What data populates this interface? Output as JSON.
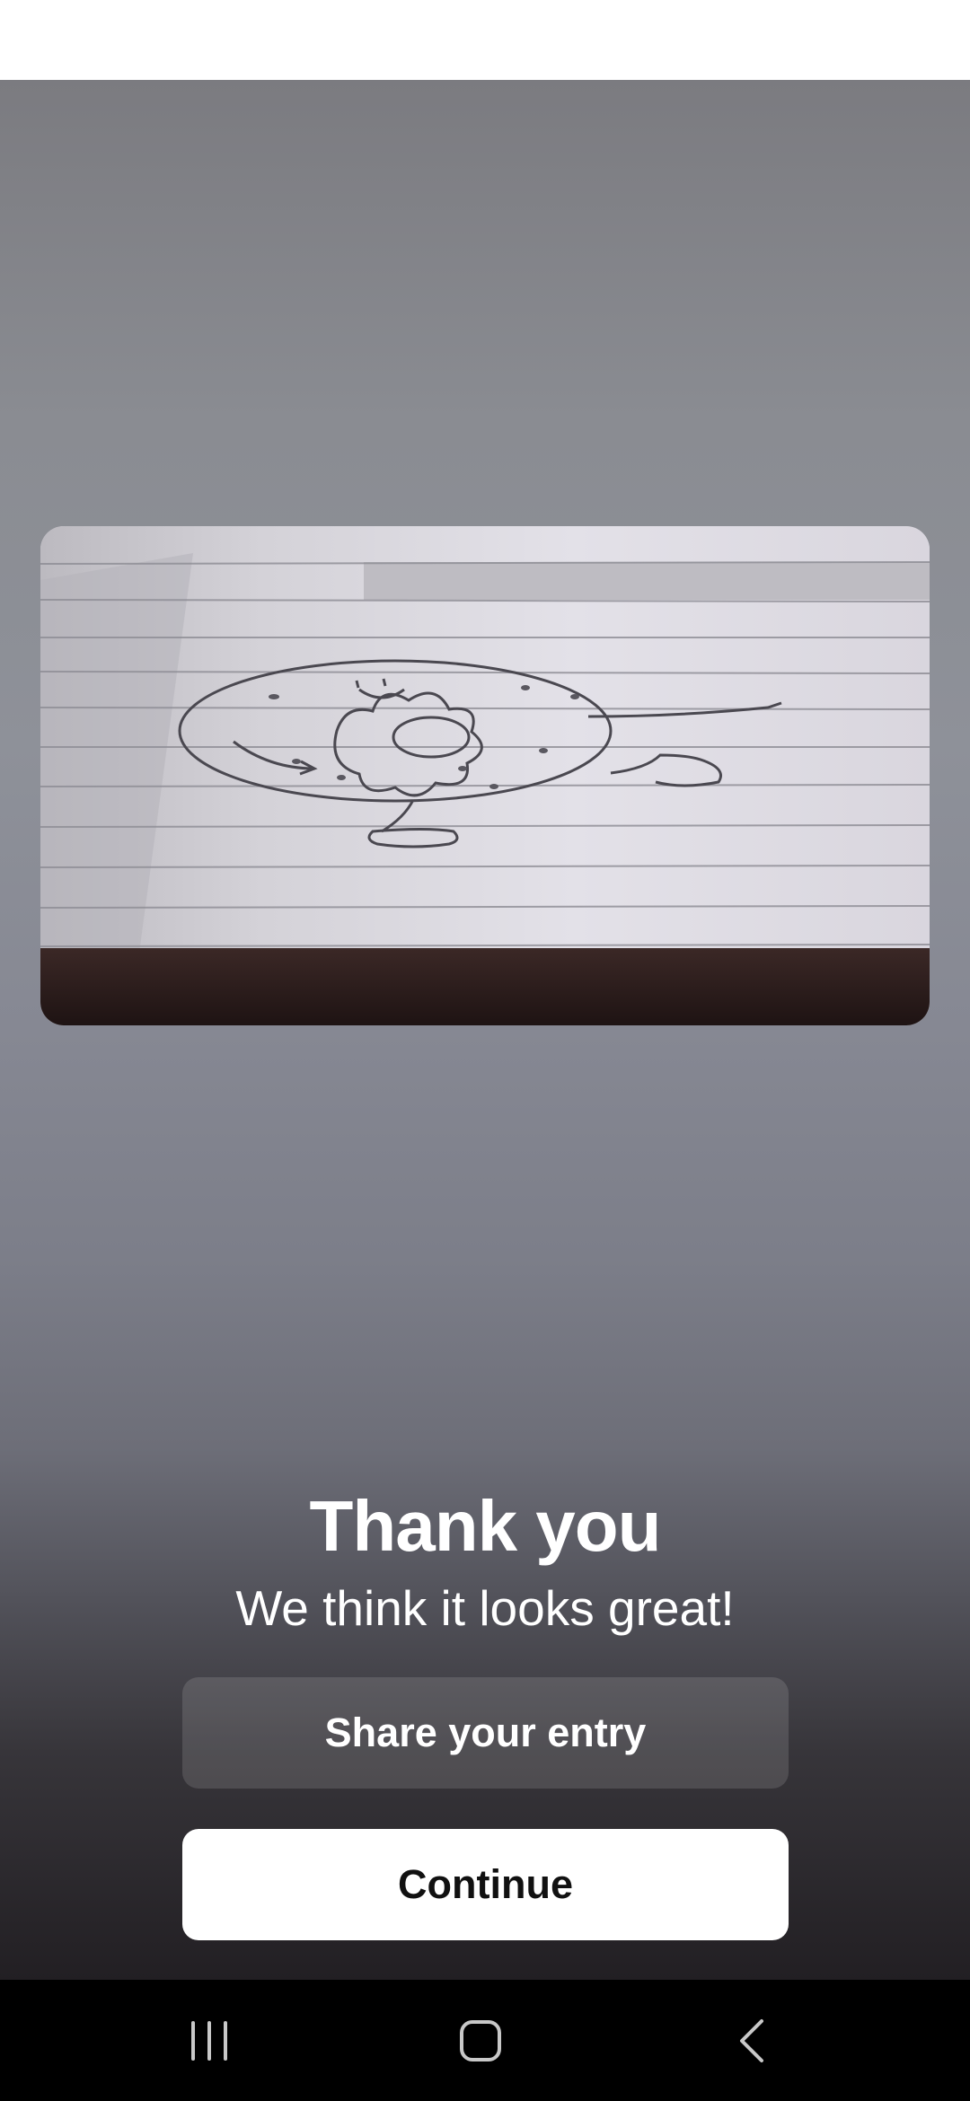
{
  "thank_you": {
    "title": "Thank you",
    "subtitle": "We think it looks great!"
  },
  "buttons": {
    "share_label": "Share your entry",
    "continue_label": "Continue"
  },
  "photo": {
    "subject": "donut-drawing"
  },
  "nav": {
    "recents_icon": "recents-icon",
    "home_icon": "home-icon",
    "back_icon": "back-icon"
  },
  "colors": {
    "button_primary_bg": "#ffffff",
    "button_secondary_bg": "#5a5a5f",
    "text": "#ffffff",
    "nav_bg": "#000000"
  }
}
